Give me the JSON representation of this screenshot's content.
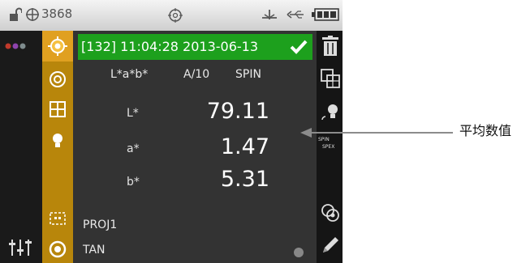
{
  "status_bar": {
    "count": "3868",
    "icons": [
      "lock-open-icon",
      "target-icon",
      "reference-icon",
      "usb-icon",
      "usb-link-icon",
      "battery-icon"
    ]
  },
  "measurement": {
    "header": "[132] 11:04:28 2013-06-13",
    "color_space": "L*a*b*",
    "illuminant": "A/10",
    "mode": "SPIN",
    "rows": [
      {
        "label": "L*",
        "value": "79.11"
      },
      {
        "label": "a*",
        "value": "1.47"
      },
      {
        "label": "b*",
        "value": "5.31"
      }
    ],
    "project": "PROJ1",
    "standard": "TAN"
  },
  "right_toolbar": {
    "spin_label": "SPIN",
    "spex_label": "SPEX"
  },
  "annotation": {
    "label": "平均数值"
  },
  "colors": {
    "header_green": "#1da01d",
    "gold": "#b8860b",
    "screen": "#333333"
  }
}
